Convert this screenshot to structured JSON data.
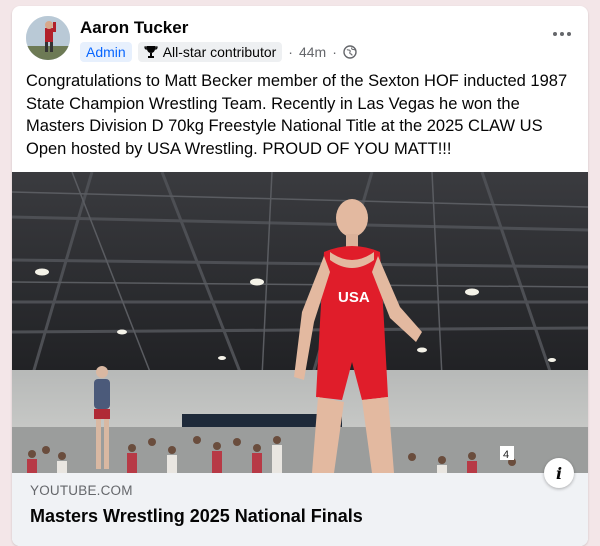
{
  "post": {
    "author": "Aaron Tucker",
    "role_badge": "Admin",
    "contributor_badge": "All-star contributor",
    "separator": "·",
    "time": "44m",
    "privacy_icon": "globe-icon",
    "more_icon": "more-horizontal-icon",
    "text": "Congratulations to Matt Becker member of the Sexton HOF inducted 1987 State Champion Wrestling Team. Recently in Las Vegas he won the Masters Division D 70kg Freestyle National Title at the 2025 CLAW US Open hosted by USA Wrestling. PROUD OF YOU MATT!!!"
  },
  "link": {
    "domain": "YOUTUBE.COM",
    "title": "Masters Wrestling 2025 National Finals",
    "info_label": "i"
  },
  "media": {
    "singlet_text": "USA",
    "mat_marker": "4"
  },
  "colors": {
    "accent": "#0866ff",
    "background": "#f3e6e8",
    "card": "#ffffff",
    "footer": "#f0f2f5",
    "singlet": "#e01d2a"
  }
}
